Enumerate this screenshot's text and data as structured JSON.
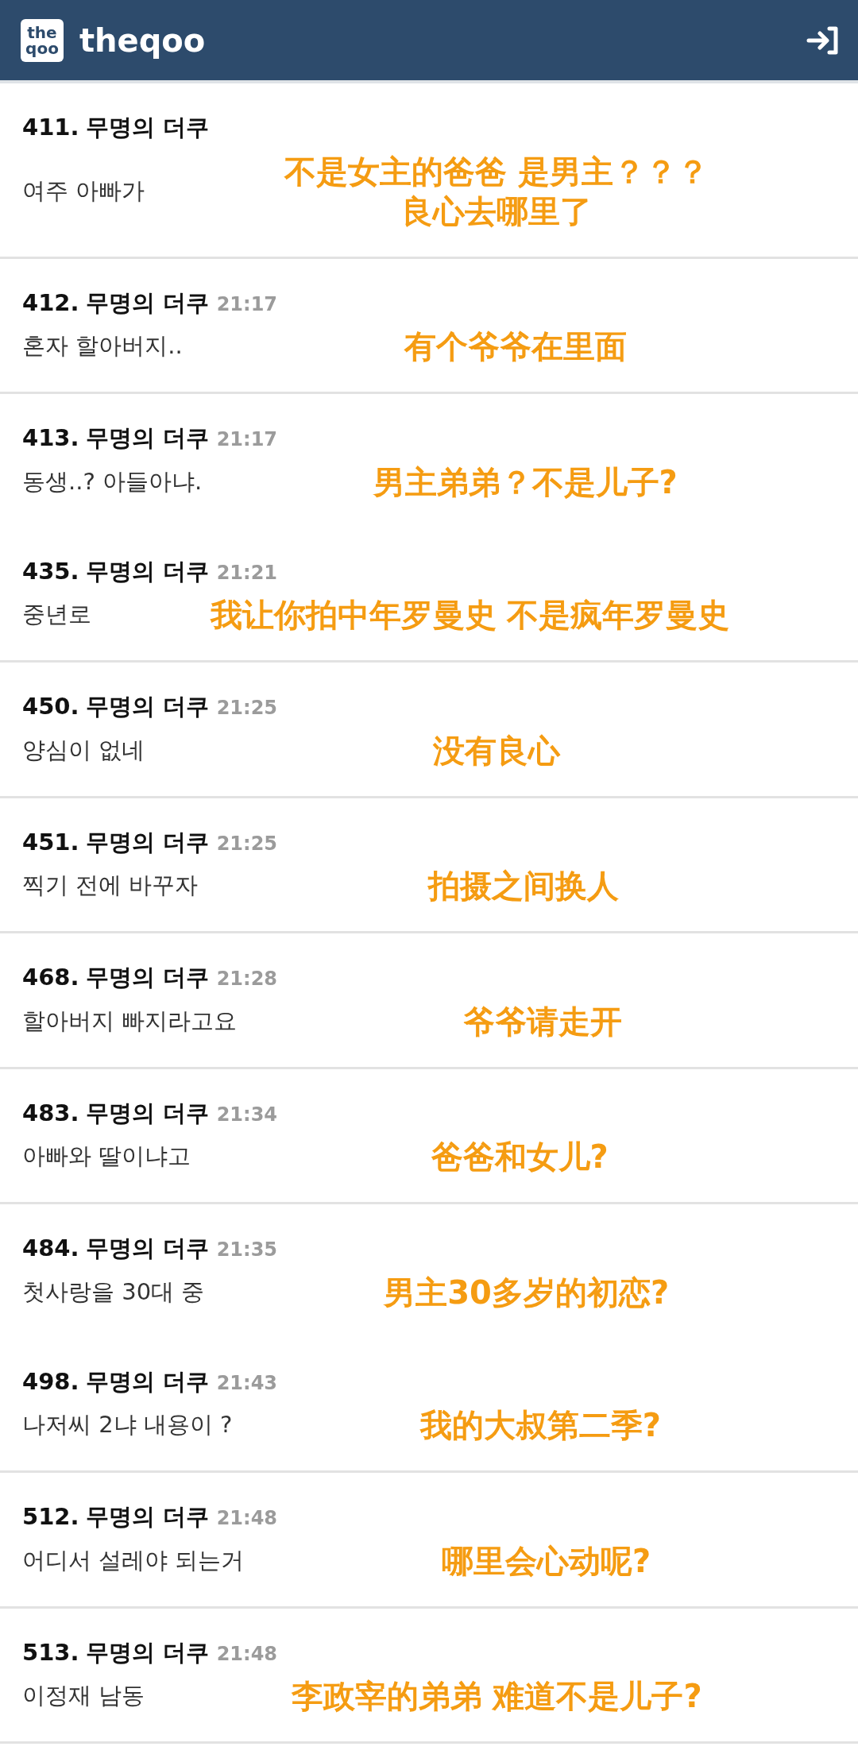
{
  "header": {
    "logo_lines": [
      "the",
      "qoo"
    ],
    "brand": "theqoo"
  },
  "comments": [
    {
      "number": "411.",
      "author": "무명의 더쿠",
      "body": "여주 아빠가",
      "caption": [
        "不是女主的爸爸 是男主？？？",
        "良心去哪里了"
      ],
      "divider": true
    },
    {
      "number": "412.",
      "author": "무명의 더쿠",
      "time": "21:17",
      "body": "혼자 할아버지..",
      "caption": [
        "有个爷爷在里面"
      ],
      "divider": true
    },
    {
      "number": "413.",
      "author": "무명의 더쿠",
      "time": "21:17",
      "body": "동생..? 아들아냐.",
      "caption": [
        "男主弟弟？不是儿子?"
      ],
      "divider": false
    },
    {
      "number": "435.",
      "author": "무명의 더쿠",
      "time": "21:21",
      "body": "중년로",
      "caption": [
        "我让你拍中年罗曼史 不是疯年罗曼史"
      ],
      "divider": true
    },
    {
      "number": "450.",
      "author": "무명의 더쿠",
      "time": "21:25",
      "body": "양심이 없네",
      "caption": [
        "没有良心"
      ],
      "divider": true
    },
    {
      "number": "451.",
      "author": "무명의 더쿠",
      "time": "21:25",
      "body": "찍기 전에 바꾸자",
      "caption": [
        "拍摄之间换人"
      ],
      "divider": true
    },
    {
      "number": "468.",
      "author": "무명의 더쿠",
      "time": "21:28",
      "body": "할아버지 빠지라고요",
      "caption": [
        "爷爷请走开"
      ],
      "divider": true
    },
    {
      "number": "483.",
      "author": "무명의 더쿠",
      "time": "21:34",
      "body": "아빠와 딸이냐고",
      "caption": [
        "爸爸和女儿?"
      ],
      "divider": true
    },
    {
      "number": "484.",
      "author": "무명의 더쿠",
      "time": "21:35",
      "body": "첫사랑을 30대 중",
      "caption": [
        "男主30多岁的初恋?"
      ],
      "divider": false
    },
    {
      "number": "498.",
      "author": "무명의 더쿠",
      "time": "21:43",
      "body": "나저씨 2냐 내용이 ?",
      "caption": [
        "我的大叔第二季?"
      ],
      "divider": true
    },
    {
      "number": "512.",
      "author": "무명의 더쿠",
      "time": "21:48",
      "body": "어디서 설레야 되는거",
      "caption": [
        "哪里会心动呢?"
      ],
      "divider": true
    },
    {
      "number": "513.",
      "author": "무명의 더쿠",
      "time": "21:48",
      "body": "이정재 남동",
      "caption": [
        "李政宰的弟弟 难道不是儿子?"
      ],
      "divider": true
    }
  ]
}
